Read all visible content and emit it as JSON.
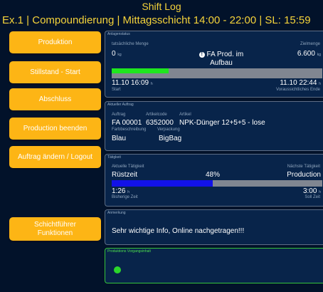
{
  "header": {
    "title": "Shift Log",
    "subtitle": "Ex.1 | Compoundierung | Mittagsschicht 14:00 - 22:00 | SL:    15:59"
  },
  "buttons": {
    "produktion": "Produktion",
    "stillstand": "Stillstand - Start",
    "abschluss": "Abschluss",
    "production_beenden": "Production beenden",
    "auftrag_aendern": "Auftrag ändern / Logout",
    "schichtfuehrer_line1": "Schichtführer",
    "schichtfuehrer_line2": "Funktionen"
  },
  "anlagenstatus": {
    "title": "Anlagenstatus",
    "actual_label": "tatsächliche Menge",
    "actual_value": "0",
    "actual_unit": "kg",
    "target_label": "Zielmenge",
    "target_value": "6.600",
    "target_unit": "kg",
    "status_line1": "FA Prod. im",
    "status_line2": "Aufbau",
    "progress": 0.27,
    "start_value": "11.10 16:09",
    "start_unit": "h",
    "start_label": "Start",
    "end_value": "11.10 22:44",
    "end_unit": "h",
    "end_label": "Voraussichtliches Ende"
  },
  "auftrag": {
    "title": "Aktueller Auftrag",
    "auftrag_label": "Auftrag",
    "artikelcode_label": "Artikelcode",
    "artikel_label": "Artikel",
    "auftrag_value": "FA 00001",
    "artikelcode_value": "6352000",
    "artikel_value": "NPK-Dünger 12+5+5 - lose",
    "farbe_label": "Farbbeschreibung",
    "verpackung_label": "Verpackung",
    "farbe_value": "Blau",
    "verpackung_value": "BigBag"
  },
  "taetigkeit": {
    "title": "Tätigkeit",
    "current_label": "Aktuelle Tätigkeit",
    "next_label": "Nächste Tätigkeit",
    "current_value": "Rüstzeit",
    "percent": "48%",
    "progress": 0.48,
    "next_value": "Production",
    "elapsed_value": "1:26",
    "elapsed_unit": "h",
    "elapsed_label": "Bisherige Zeit",
    "target_value": "3:00",
    "target_unit": "h",
    "target_label": "Soll Zeit"
  },
  "anmerkung": {
    "title": "Anmerkung",
    "text": "Sehr wichtige Info, Online nachgetragen!!!"
  },
  "vorgangsinhalt": {
    "title": "Produktions Vorgangsinhalt"
  },
  "colors": {
    "accent": "#fdb515",
    "header": "#f5d33a",
    "progress_green": "#1fe61f",
    "progress_blue": "#1212e8",
    "status_dot": "#2bd62b"
  }
}
